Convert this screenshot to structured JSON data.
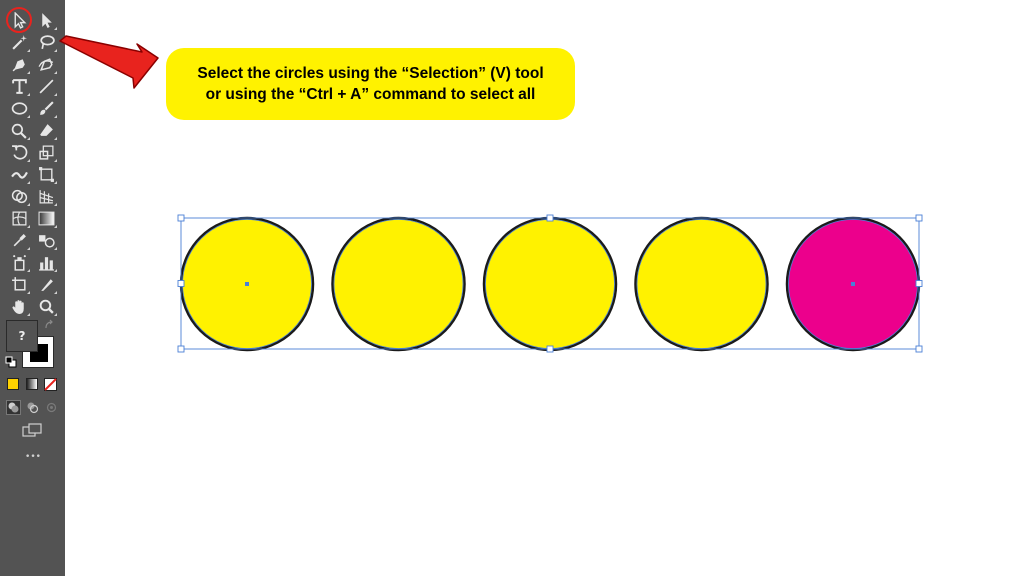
{
  "toolbar": {
    "fill_question": "?",
    "more_dots": "•••"
  },
  "callout": {
    "line1": "Select the circles using the “Selection” (V) tool",
    "line2": "or using the “Ctrl + A” command to select all"
  },
  "canvas": {
    "circles": [
      {
        "fill": "#fff200"
      },
      {
        "fill": "#fff200"
      },
      {
        "fill": "#fff200"
      },
      {
        "fill": "#fff200"
      },
      {
        "fill": "#ec008c"
      }
    ],
    "stroke_color": "#1a1a1a",
    "selection_color": "#4a7fd6"
  },
  "colors": {
    "toolbar_bg": "#535353",
    "callout_bg": "#fff200",
    "arrow": "#e8231e"
  }
}
